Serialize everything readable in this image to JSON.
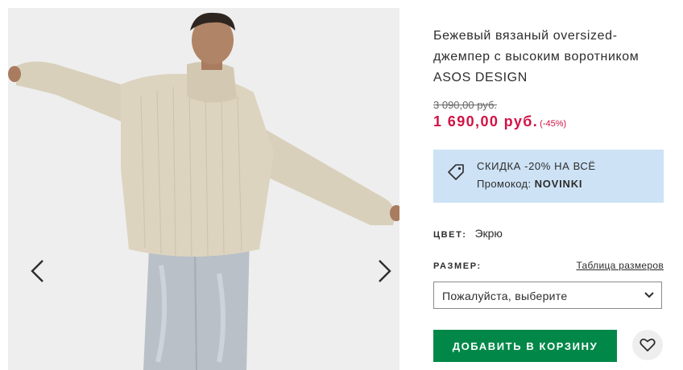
{
  "product": {
    "title": "Бежевый вязаный oversized-джемпер с высоким воротником ASOS DESIGN",
    "old_price": "3 090,00 руб.",
    "price": "1 690,00 руб.",
    "discount": "(-45%)"
  },
  "promo": {
    "line1": "СКИДКА -20% НА ВСЁ",
    "code_label": "Промокод:",
    "code": "NOVINKI",
    "icon": "tag-icon",
    "background": "#cde2f5"
  },
  "color": {
    "label": "ЦВЕТ:",
    "value": "Экрю"
  },
  "size": {
    "label": "РАЗМЕР:",
    "guide_link": "Таблица размеров",
    "placeholder": "Пожалуйста, выберите"
  },
  "actions": {
    "add_to_cart": "ДОБАВИТЬ В КОРЗИНУ",
    "add_color": "#018849",
    "save_icon": "heart-icon"
  },
  "gallery": {
    "prev_icon": "chevron-left-icon",
    "next_icon": "chevron-right-icon",
    "image_alt": "product-photo"
  },
  "colors": {
    "sale": "#d01345",
    "text": "#2d2d2d"
  }
}
